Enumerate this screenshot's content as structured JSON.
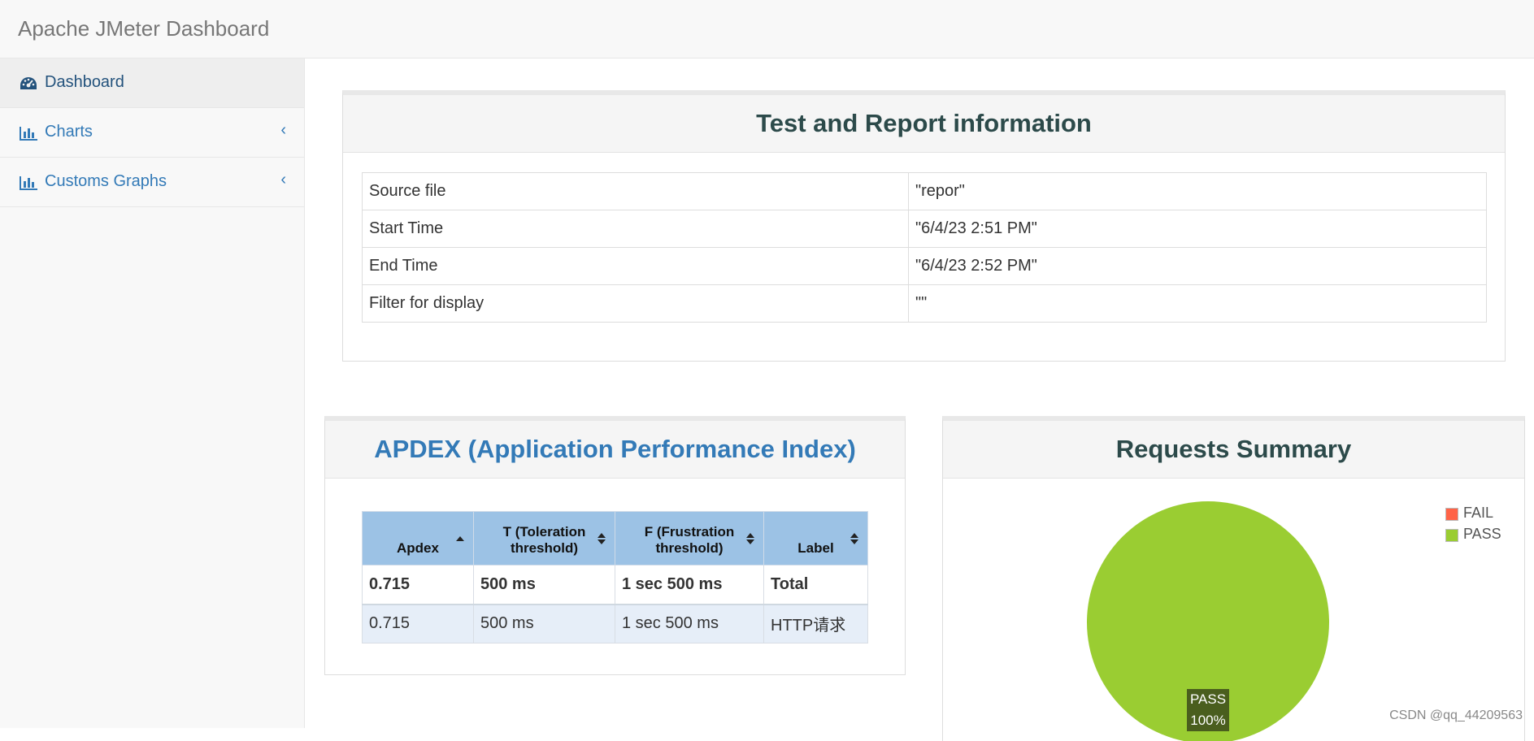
{
  "app": {
    "title": "Apache JMeter Dashboard"
  },
  "sidebar": {
    "items": [
      {
        "label": "Dashboard",
        "icon": "dashboard-gauge-icon"
      },
      {
        "label": "Charts",
        "icon": "bar-chart-icon"
      },
      {
        "label": "Customs Graphs",
        "icon": "bar-chart-icon"
      }
    ]
  },
  "info_panel": {
    "title": "Test and Report information",
    "rows": [
      {
        "key": "Source file",
        "value": "\"repor\""
      },
      {
        "key": "Start Time",
        "value": "\"6/4/23 2:51 PM\""
      },
      {
        "key": "End Time",
        "value": "\"6/4/23 2:52 PM\""
      },
      {
        "key": "Filter for display",
        "value": "\"\""
      }
    ]
  },
  "apdex_panel": {
    "title": "APDEX (Application Performance Index)",
    "columns": [
      "Apdex",
      "T (Toleration threshold)",
      "F (Frustration threshold)",
      "Label"
    ],
    "rows": [
      [
        "0.715",
        "500 ms",
        "1 sec 500 ms",
        "Total"
      ],
      [
        "0.715",
        "500 ms",
        "1 sec 500 ms",
        "HTTP请求"
      ]
    ]
  },
  "requests_panel": {
    "title": "Requests Summary",
    "legend": [
      {
        "label": "FAIL",
        "color": "#ff6347"
      },
      {
        "label": "PASS",
        "color": "#9acd32"
      }
    ],
    "pie_label": {
      "name": "PASS",
      "percent": "100%"
    }
  },
  "chart_data": {
    "type": "pie",
    "categories": [
      "FAIL",
      "PASS"
    ],
    "values": [
      0,
      100
    ],
    "colors": [
      "#ff6347",
      "#9acd32"
    ],
    "legend": "top-right"
  },
  "watermark": "CSDN @qq_44209563"
}
